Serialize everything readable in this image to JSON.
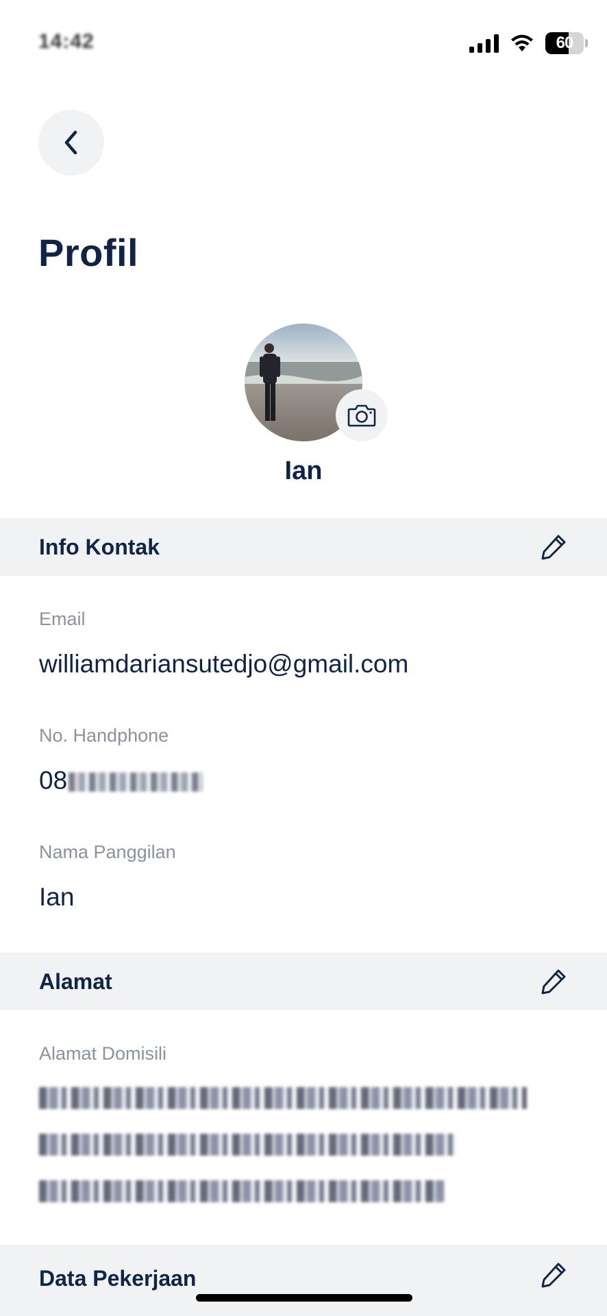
{
  "status_bar": {
    "time": "14:42",
    "battery_percent": "60",
    "battery_level": 0.6
  },
  "header": {
    "back_icon": "chevron-left-icon",
    "title": "Profil"
  },
  "profile": {
    "name": "Ian",
    "camera_icon": "camera-icon"
  },
  "sections": {
    "contact": {
      "title": "Info Kontak",
      "edit_icon": "pencil-icon",
      "fields": [
        {
          "label": "Email",
          "value": "williamdariansutedjo@gmail.com"
        },
        {
          "label": "No. Handphone",
          "value": "08"
        },
        {
          "label": "Nama Panggilan",
          "value": "Ian"
        }
      ]
    },
    "address": {
      "title": "Alamat",
      "edit_icon": "pencil-icon",
      "fields": [
        {
          "label": "Alamat Domisili"
        }
      ]
    },
    "job": {
      "title": "Data Pekerjaan",
      "edit_icon": "pencil-icon"
    }
  },
  "colors": {
    "primary_text": "#0f2447",
    "label_text": "#8a929f",
    "section_bg": "#f1f2f4",
    "background": "#ffffff"
  }
}
